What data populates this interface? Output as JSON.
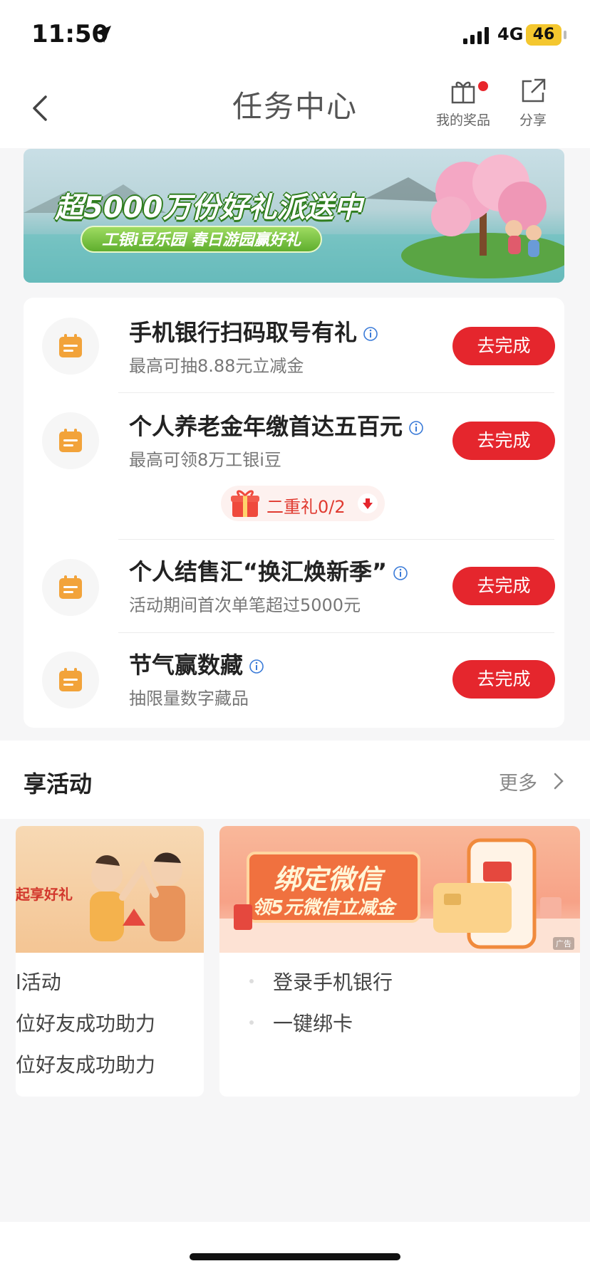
{
  "status_bar": {
    "time": "11:50",
    "network": "4G",
    "battery": "46"
  },
  "nav": {
    "title": "任务中心",
    "prizes_label": "我的奖品",
    "share_label": "分享"
  },
  "banner": {
    "title": "超5000万份好礼派送中",
    "subtitle": "工银i豆乐园 春日游园赢好礼"
  },
  "tasks": [
    {
      "title": "手机银行扫码取号有礼",
      "desc": "最高可抽8.88元立减金",
      "button": "去完成"
    },
    {
      "title": "个人养老金年缴首达五百元",
      "desc": "最高可领8万工银i豆",
      "button": "去完成",
      "extra": "二重礼0/2"
    },
    {
      "title": "个人结售汇“换汇焕新季”",
      "desc": "活动期间首次单笔超过5000元",
      "button": "去完成"
    },
    {
      "title": "节气赢数藏",
      "desc": "抽限量数字藏品",
      "button": "去完成"
    }
  ],
  "activities": {
    "title": "享活动",
    "more": "更多",
    "left_card": {
      "image_text": "起享好礼",
      "items": [
        "l活动",
        "位好友成功助力",
        "位好友成功助力"
      ]
    },
    "right_card": {
      "image_title": "绑定微信",
      "image_sub": "领5元微信立减金",
      "ad_label": "广告",
      "items": [
        "登录手机银行",
        "一键绑卡"
      ]
    }
  },
  "colors": {
    "accent_red": "#e5262d",
    "icon_orange": "#f2a33a",
    "info_blue": "#3b7bd8"
  }
}
